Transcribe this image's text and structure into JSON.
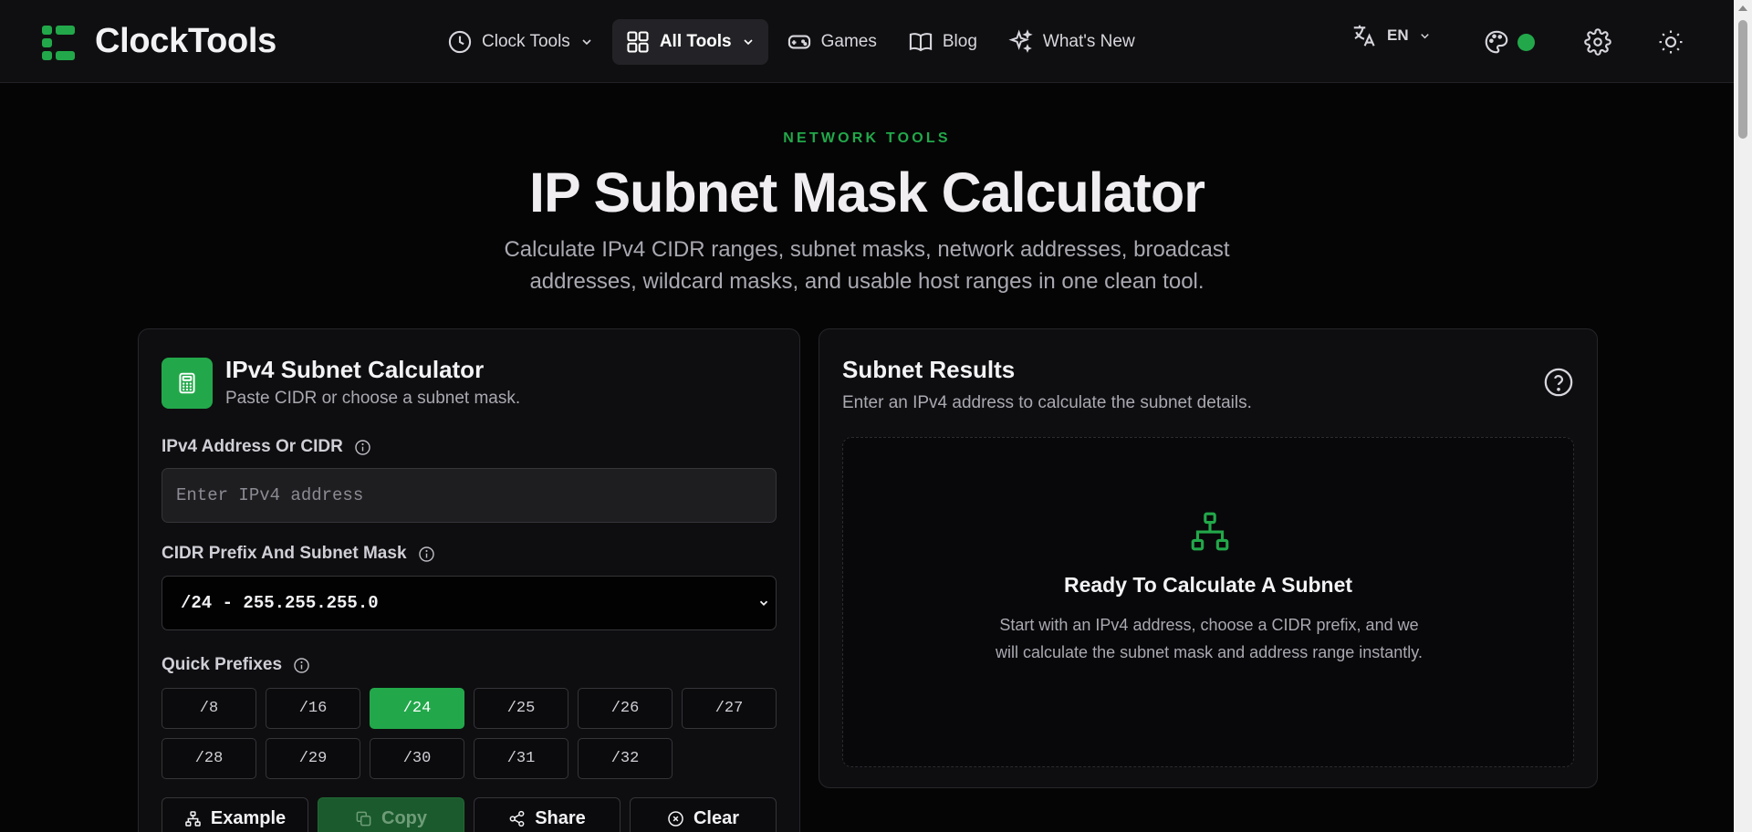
{
  "header": {
    "logo_text": "ClockTools",
    "nav": [
      {
        "label": "Clock Tools",
        "icon": "clock-icon",
        "dropdown": true
      },
      {
        "label": "All Tools",
        "icon": "grid-icon",
        "dropdown": true,
        "active": true
      },
      {
        "label": "Games",
        "icon": "gamepad-icon"
      },
      {
        "label": "Blog",
        "icon": "book-icon"
      },
      {
        "label": "What's New",
        "icon": "sparkles-icon"
      }
    ],
    "language": "EN",
    "accent_color": "#22a84a"
  },
  "hero": {
    "eyebrow": "NETWORK TOOLS",
    "title": "IP Subnet Mask Calculator",
    "subtitle": "Calculate IPv4 CIDR ranges, subnet masks, network addresses, broadcast addresses, wildcard masks, and usable host ranges in one clean tool."
  },
  "calculator": {
    "title": "IPv4 Subnet Calculator",
    "subtitle": "Paste CIDR or choose a subnet mask.",
    "ip_label": "IPv4 Address Or CIDR",
    "ip_placeholder": "Enter IPv4 address",
    "ip_value": "",
    "cidr_label": "CIDR Prefix And Subnet Mask",
    "cidr_selected": "/24 - 255.255.255.0",
    "quick_label": "Quick Prefixes",
    "prefixes": [
      "/8",
      "/16",
      "/24",
      "/25",
      "/26",
      "/27",
      "/28",
      "/29",
      "/30",
      "/31",
      "/32"
    ],
    "active_prefix": "/24",
    "actions": [
      {
        "label": "Example",
        "icon": "network-icon"
      },
      {
        "label": "Copy",
        "icon": "copy-icon",
        "disabled": true
      },
      {
        "label": "Share",
        "icon": "share-icon"
      },
      {
        "label": "Clear",
        "icon": "clear-icon"
      }
    ]
  },
  "results": {
    "title": "Subnet Results",
    "subtitle": "Enter an IPv4 address to calculate the subnet details.",
    "empty_title": "Ready To Calculate A Subnet",
    "empty_text": "Start with an IPv4 address, choose a CIDR prefix, and we will calculate the subnet mask and address range instantly."
  }
}
